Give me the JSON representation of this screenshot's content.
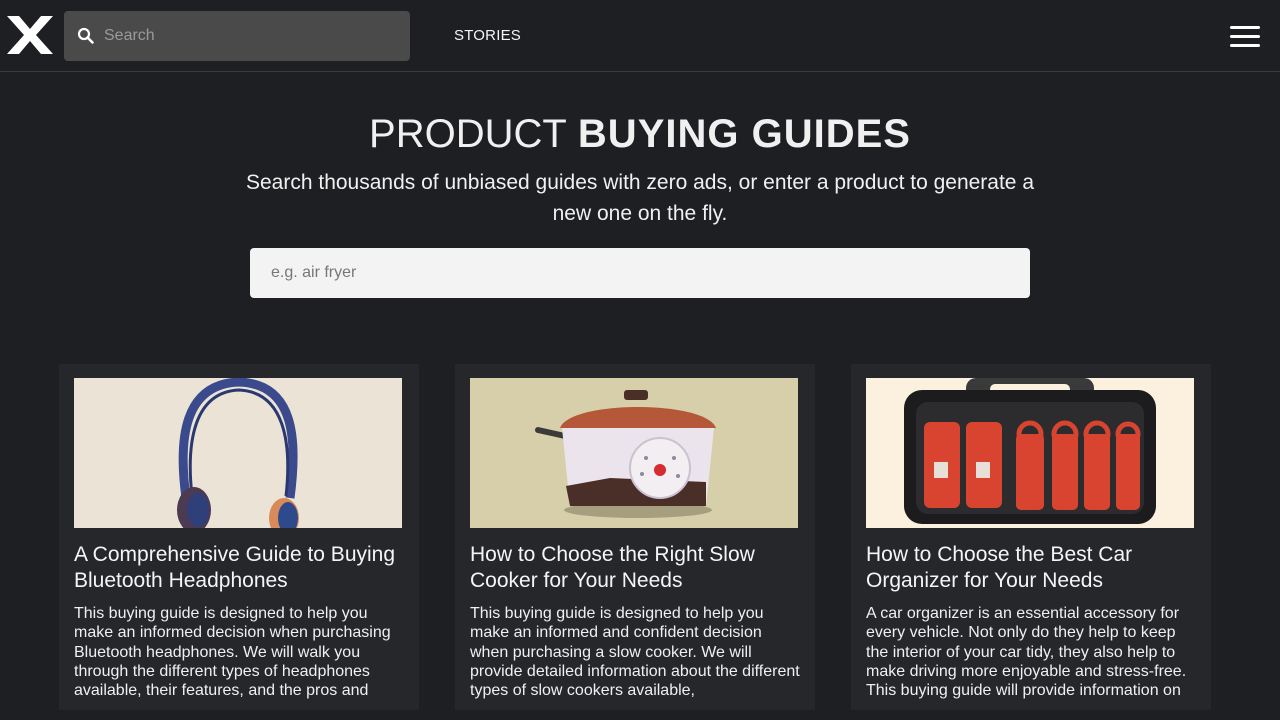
{
  "header": {
    "search_placeholder": "Search",
    "nav_stories": "STORIES"
  },
  "hero": {
    "title_light": "PRODUCT",
    "title_bold": "BUYING GUIDES",
    "subtitle": "Search thousands of unbiased guides with zero ads, or enter a product to generate a new one on the fly.",
    "search_placeholder": "e.g. air fryer"
  },
  "cards": [
    {
      "title": "A Comprehensive Guide to Buying Bluetooth Headphones",
      "excerpt": "This buying guide is designed to help you make an informed decision when purchasing Bluetooth headphones. We will walk you through the different types of headphones available, their features, and the pros and",
      "image": "headphones-illustration"
    },
    {
      "title": "How to Choose the Right Slow Cooker for Your Needs",
      "excerpt": "This buying guide is designed to help you make an informed and confident decision when purchasing a slow cooker. We will provide detailed information about the different types of slow cookers available,",
      "image": "slow-cooker-illustration"
    },
    {
      "title": "How to Choose the Best Car Organizer for Your Needs",
      "excerpt": "A car organizer is an essential accessory for every vehicle. Not only do they help to keep the interior of your car tidy, they also help to make driving more enjoyable and stress-free. This buying guide will provide information on",
      "image": "car-organizer-illustration"
    }
  ]
}
